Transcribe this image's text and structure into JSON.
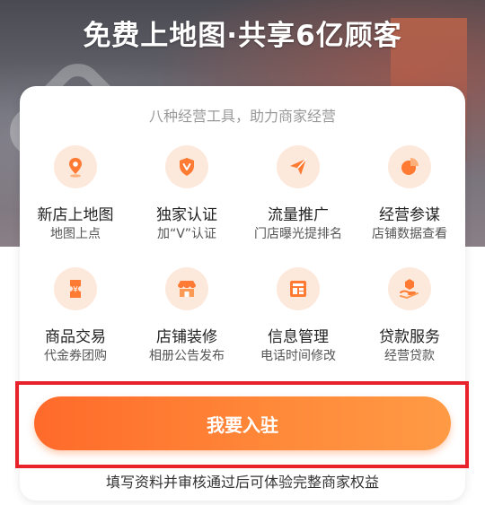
{
  "hero": {
    "headline": "免费上地图·共享6亿顾客"
  },
  "card": {
    "subtitle": "八种经营工具，助力商家经营",
    "tools": [
      {
        "title": "新店上地图",
        "desc": "地图上点",
        "icon": "map-pin-icon"
      },
      {
        "title": "独家认证",
        "desc": "加“V”认证",
        "icon": "verified-shield-icon"
      },
      {
        "title": "流量推广",
        "desc": "门店曝光提排名",
        "icon": "send-arrow-icon"
      },
      {
        "title": "经营参谋",
        "desc": "店铺数据查看",
        "icon": "pie-chart-icon"
      },
      {
        "title": "商品交易",
        "desc": "代金券团购",
        "icon": "coupon-icon"
      },
      {
        "title": "店铺装修",
        "desc": "相册公告发布",
        "icon": "storefront-icon"
      },
      {
        "title": "信息管理",
        "desc": "电话时间修改",
        "icon": "info-layout-icon"
      },
      {
        "title": "贷款服务",
        "desc": "经营贷款",
        "icon": "loan-hand-icon"
      }
    ]
  },
  "action": {
    "join_label": "我要入驻",
    "footnote": "填写资料并审核通过后可体验完整商家权益"
  },
  "colors": {
    "accent": "#ff7a33",
    "icon_bg": "#fde9dc",
    "highlight": "#e8222a"
  }
}
